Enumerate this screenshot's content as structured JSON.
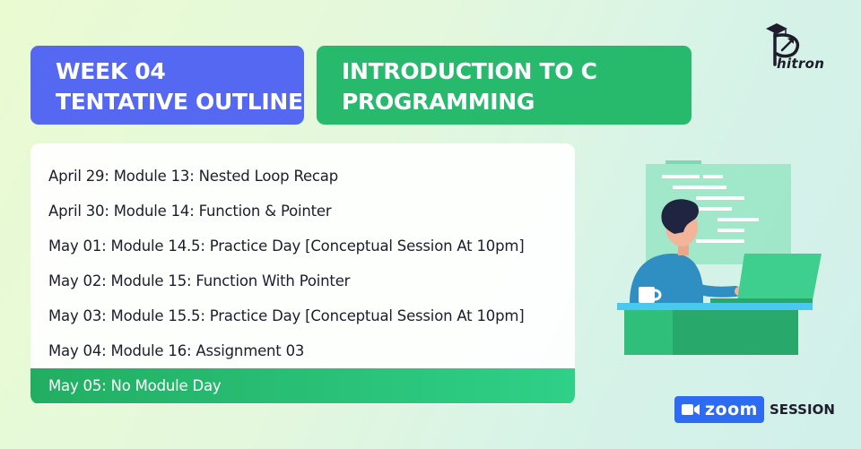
{
  "header": {
    "week_line1": "WEEK 04",
    "week_line2": "TENTATIVE OUTLINE",
    "title_line1": "INTRODUCTION TO C",
    "title_line2": "PROGRAMMING"
  },
  "outline": {
    "items": [
      {
        "text": "April 29: Module 13: Nested Loop Recap",
        "highlighted": false
      },
      {
        "text": "April 30: Module 14: Function & Pointer",
        "highlighted": false
      },
      {
        "text": "May 01: Module 14.5: Practice Day [Conceptual Session At 10pm]",
        "highlighted": false
      },
      {
        "text": "May 02: Module 15: Function With Pointer",
        "highlighted": false
      },
      {
        "text": "May 03: Module 15.5: Practice Day [Conceptual Session At 10pm]",
        "highlighted": false
      },
      {
        "text": "May 04: Module 16: Assignment 03",
        "highlighted": false
      },
      {
        "text": "May 05: No Module Day",
        "highlighted": true
      }
    ]
  },
  "brand": {
    "logo_text": "hitron",
    "logo_icon": "graduation-cap-arrow-icon"
  },
  "footer": {
    "zoom_label": "zoom",
    "session_label": "SESSION",
    "zoom_icon": "video-camera-icon"
  },
  "colors": {
    "week_box": "#5468f2",
    "title_box": "#27b96c",
    "highlight": "#2fd088",
    "zoom_blue": "#2d6cf2"
  }
}
